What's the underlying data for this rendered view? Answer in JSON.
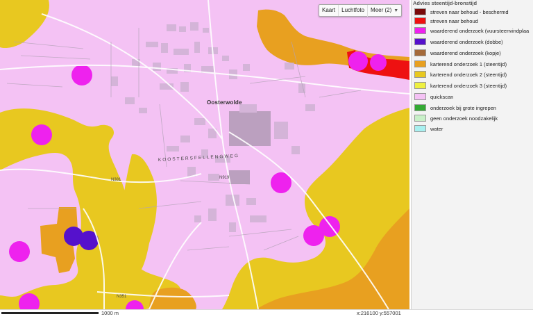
{
  "map": {
    "place_label": "Oosterwolde",
    "road_label_1": "N381",
    "road_label_2": "N919",
    "road_label_3": "N351",
    "street_label": "KOOSTERSFELLENGWEG"
  },
  "map_type": {
    "options": [
      "Kaart",
      "Luchtfoto",
      "Meer (2)"
    ]
  },
  "legend": {
    "title": "Advies steentijd-bronstijd",
    "items": [
      {
        "label": "streven naar behoud - beschermd",
        "color": "#7a0a0a"
      },
      {
        "label": "streven naar behoud",
        "color": "#ee1111"
      },
      {
        "label": "waarderend onderzoek (vuursteenvindplaa",
        "color": "#ee22ee"
      },
      {
        "label": "waarderend onderzoek (dobbe)",
        "color": "#5511cc"
      },
      {
        "label": "waarderend onderzoek (kopje)",
        "color": "#a56a3a"
      },
      {
        "label": "karterend onderzoek 1 (steentijd)",
        "color": "#e8a020"
      },
      {
        "label": "karterend onderzoek 2 (steentijd)",
        "color": "#e8c820"
      },
      {
        "label": "karterend onderzoek 3 (steentijd)",
        "color": "#eef040"
      },
      {
        "label": "quickscan",
        "color": "#f4c2f4"
      },
      {
        "label": "onderzoek bij grote ingrepen",
        "color": "#33aa33"
      },
      {
        "label": "geen onderzoek noodzakelijk",
        "color": "#c8f0c8"
      },
      {
        "label": "water",
        "color": "#a8f0f0"
      }
    ]
  },
  "scale": {
    "label": "1000 m"
  },
  "coords": {
    "label": "x:216100  y:557001"
  }
}
